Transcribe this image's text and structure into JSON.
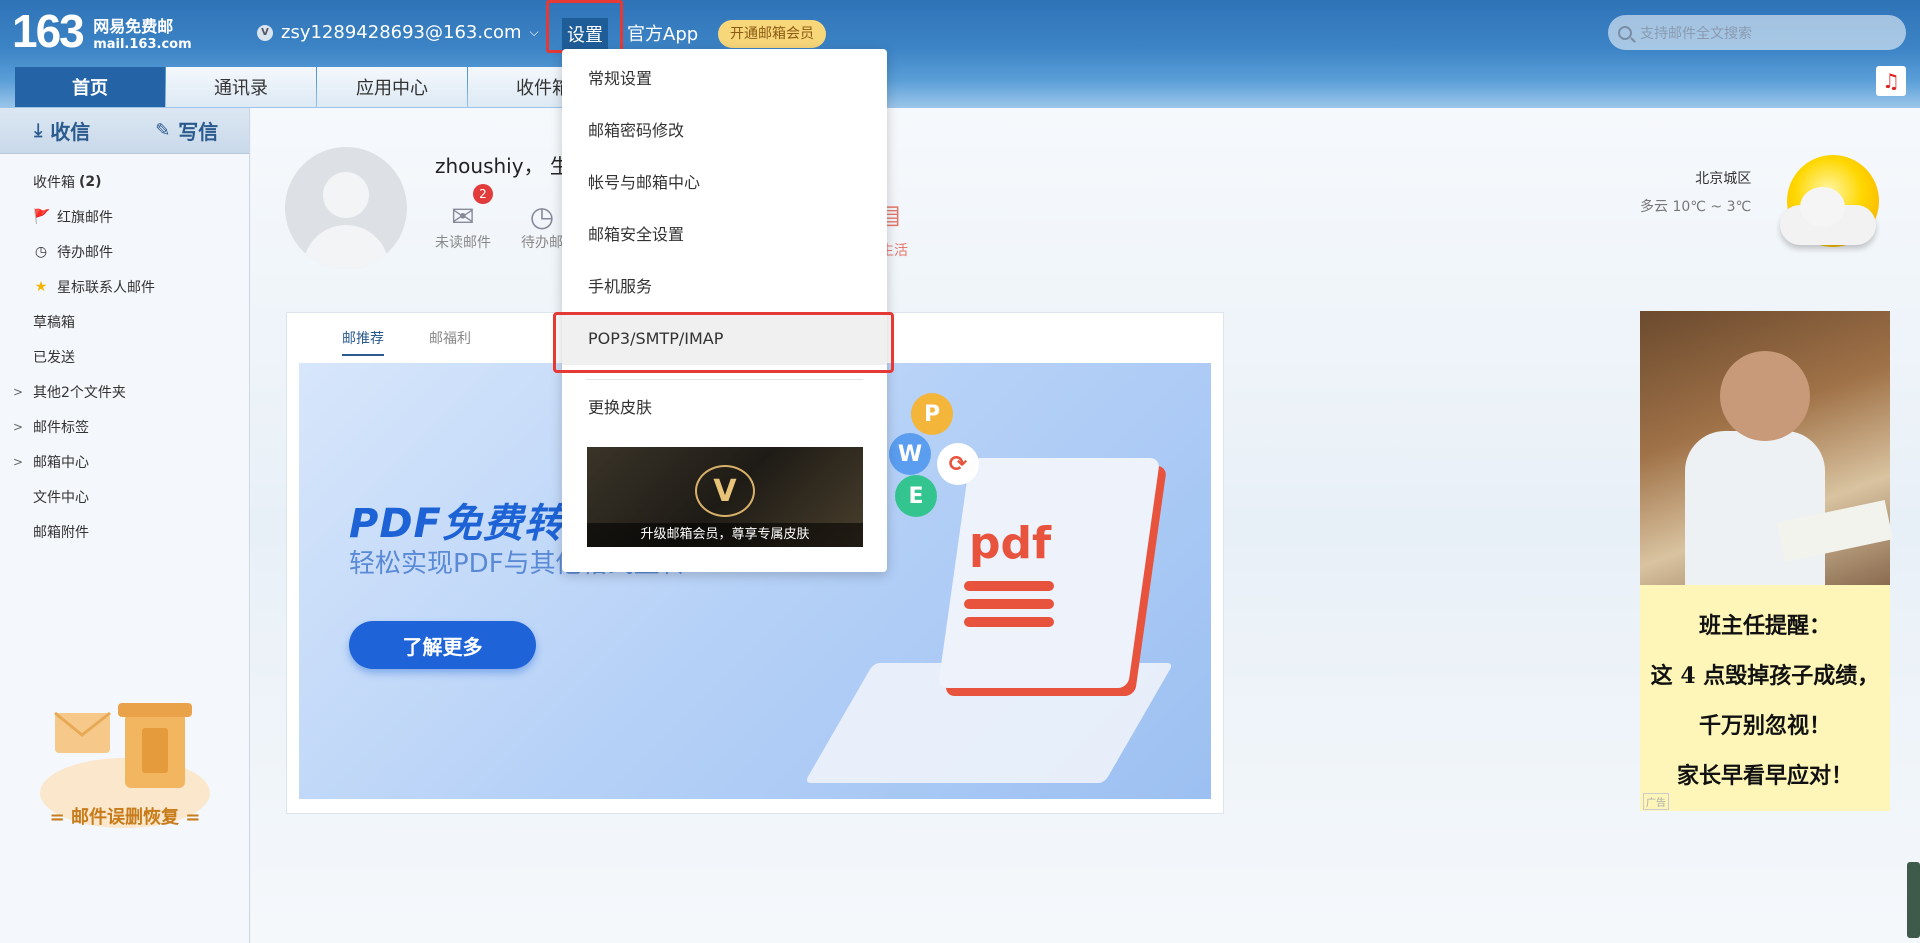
{
  "header": {
    "logo_num": "163",
    "logo_cn": "网易免费邮",
    "logo_domain": "mail.163.com",
    "vip_icon": "V",
    "account": "zsy1289428693@163.com",
    "settings": "设置",
    "official_app": "官方App",
    "vip_cta": "开通邮箱会员",
    "search_placeholder": "支持邮件全文搜索"
  },
  "tabs": [
    "首页",
    "通讯录",
    "应用中心",
    "收件箱"
  ],
  "sidebar": {
    "receive": "收信",
    "write": "写信",
    "folders": [
      {
        "label": "收件箱",
        "count": "(2)",
        "icon": ""
      },
      {
        "label": "红旗邮件",
        "icon": "🚩"
      },
      {
        "label": "待办邮件",
        "icon": "◷"
      },
      {
        "label": "星标联系人邮件",
        "icon": "★"
      },
      {
        "label": "草稿箱",
        "icon": ""
      },
      {
        "label": "已发送",
        "icon": ""
      },
      {
        "label": "其他2个文件夹",
        "icon": "",
        "arrow": ">"
      },
      {
        "label": "邮件标签",
        "icon": "",
        "arrow": ">"
      },
      {
        "label": "邮箱中心",
        "icon": "",
        "arrow": ">"
      },
      {
        "label": "文件中心",
        "icon": ""
      },
      {
        "label": "邮箱附件",
        "icon": ""
      }
    ],
    "promo": "= 邮件误删恢复 ="
  },
  "main": {
    "greeting": "zhoushiy， 生",
    "unread_count": "2",
    "unread_label": "未读邮件",
    "todo_label": "待办邮",
    "life_label": "生活",
    "weather": {
      "city": "北京城区",
      "temp": "多云 10℃ ~ 3℃"
    },
    "panel_tabs": [
      "邮推荐",
      "邮福利"
    ],
    "banner_title": "PDF免费转",
    "banner_sub": "轻松实现PDF与其他格式互转",
    "banner_btn": "了解更多",
    "pdf_text": "pdf"
  },
  "settings_menu": {
    "items": [
      "常规设置",
      "邮箱密码修改",
      "帐号与邮箱中心",
      "邮箱安全设置",
      "手机服务",
      "POP3/SMTP/IMAP"
    ],
    "skin": "更换皮肤",
    "skin_cap": "升级邮箱会员，尊享专属皮肤",
    "skin_v": "V"
  },
  "ad": {
    "lines": [
      "班主任提醒：",
      "这 4 点毁掉孩子成绩，",
      "千万别忽视！",
      "家长早看早应对！"
    ],
    "tag": "广告"
  },
  "colors": {
    "primary": "#2363a6",
    "highlight_box": "#e53935",
    "vip": "#f8d67a"
  }
}
